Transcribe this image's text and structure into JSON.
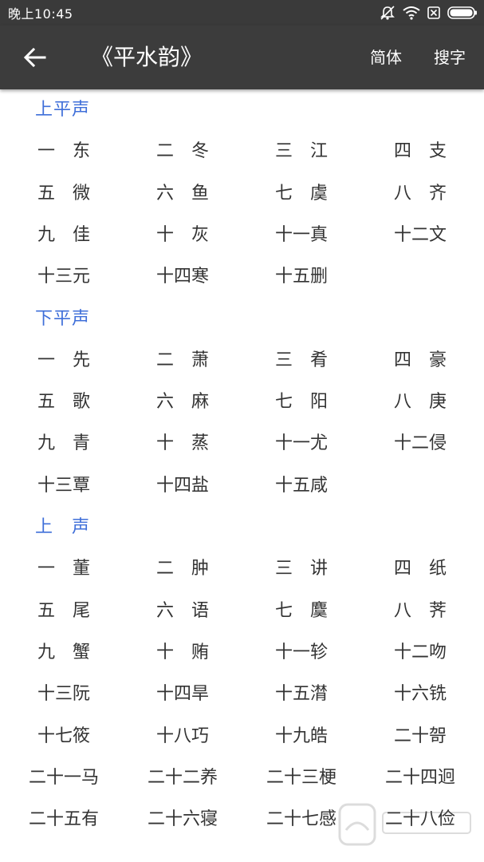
{
  "status_bar": {
    "time": "晚上10:45",
    "icons": [
      "notification-muted-icon",
      "wifi-icon",
      "sim-card-icon",
      "battery-icon"
    ]
  },
  "app_bar": {
    "title": "《平水韵》",
    "back_icon": "arrow-left-icon",
    "actions": {
      "simplified": "简体",
      "search": "搜字"
    }
  },
  "colors": {
    "appbar_bg": "#3c3c3c",
    "statusbar_bg": "#3a3a3a",
    "section_title": "#3f6fd9",
    "item_text": "#333333"
  },
  "sections": [
    {
      "title": "上平声",
      "items": [
        "一　东",
        "二　冬",
        "三　江",
        "四　支",
        "五　微",
        "六　鱼",
        "七　虞",
        "八　齐",
        "九　佳",
        "十　灰",
        "十一真",
        "十二文",
        "十三元",
        "十四寒",
        "十五删"
      ]
    },
    {
      "title": "下平声",
      "items": [
        "一　先",
        "二　萧",
        "三　肴",
        "四　豪",
        "五　歌",
        "六　麻",
        "七　阳",
        "八　庚",
        "九　青",
        "十　蒸",
        "十一尤",
        "十二侵",
        "十三覃",
        "十四盐",
        "十五咸"
      ]
    },
    {
      "title": "上　声",
      "items": [
        "一　董",
        "二　肿",
        "三　讲",
        "四　纸",
        "五　尾",
        "六　语",
        "七　麌",
        "八　荠",
        "九　蟹",
        "十　贿",
        "十一轸",
        "十二吻",
        "十三阮",
        "十四旱",
        "十五潸",
        "十六铣",
        "十七筱",
        "十八巧",
        "十九皓",
        "二十哿",
        "二十一马",
        "二十二养",
        "二十三梗",
        "二十四迥",
        "二十五有",
        "二十六寝",
        "二十七感",
        "二十八俭"
      ]
    }
  ]
}
